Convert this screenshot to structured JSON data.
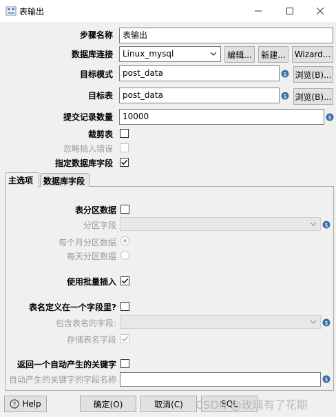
{
  "window": {
    "title": "表输出"
  },
  "fields": {
    "step_name_label": "步骤名称",
    "step_name_value": "表输出",
    "db_connection_label": "数据库连接",
    "db_connection_value": "Linux_mysql",
    "edit_button": "编辑...",
    "new_button": "新建...",
    "wizard_button": "Wizard...",
    "target_schema_label": "目标模式",
    "target_schema_value": "post_data",
    "browse_schema_button": "浏览(B)...",
    "target_table_label": "目标表",
    "target_table_value": "post_data",
    "browse_table_button": "浏览(B)...",
    "commit_size_label": "提交记录数量",
    "commit_size_value": "10000",
    "truncate_label": "裁剪表",
    "ignore_errors_label": "忽略插入错误",
    "specify_fields_label": "指定数据库字段"
  },
  "tabs": {
    "main": "主选项",
    "db_fields": "数据库字段"
  },
  "main_tab": {
    "partition_label": "表分区数据",
    "partition_field_label": "分区字段",
    "monthly_label": "每个月分区数据",
    "daily_label": "每天分区数据",
    "batch_insert_label": "使用批量插入",
    "table_name_in_field_label": "表名定义在一个字段里?",
    "table_name_field_label": "包含表名的字段:",
    "store_table_name_label": "存储表名字段",
    "return_key_label": "返回一个自动产生的关键字",
    "key_field_name_label": "自动产生的关键字的字段名称"
  },
  "footer": {
    "help_button": "Help",
    "ok_button": "确定(O)",
    "cancel_button": "取消(C)",
    "sql_button": "SQL",
    "watermark": "CSDN @玫瑰有了花期"
  },
  "state": {
    "truncate_checked": false,
    "ignore_errors_checked": false,
    "specify_fields_checked": true,
    "partition_checked": false,
    "monthly_selected": true,
    "daily_selected": false,
    "batch_insert_checked": true,
    "table_name_in_field_checked": false,
    "store_table_name_checked": true,
    "return_key_checked": false
  },
  "colors": {
    "accent": "#1a5fb4",
    "window_bg": "#f0f0f0"
  }
}
